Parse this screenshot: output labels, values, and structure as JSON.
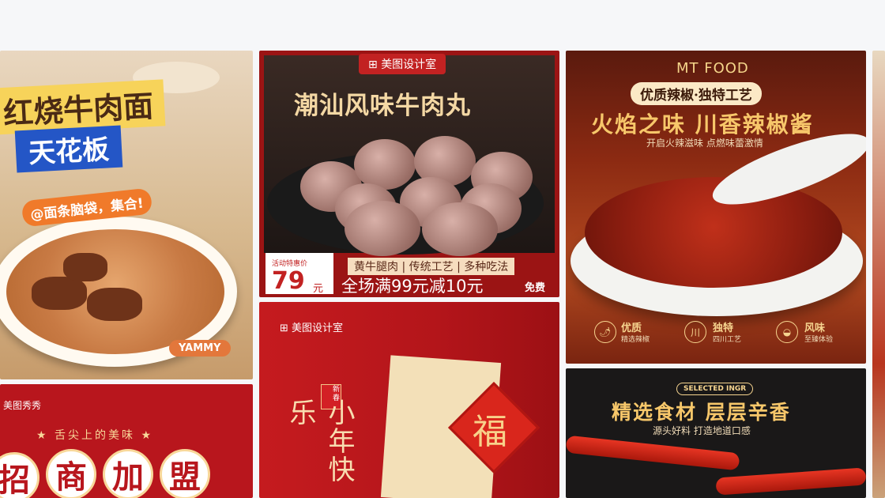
{
  "cards": {
    "noodle": {
      "title": "红烧牛肉面",
      "badge": "天花板",
      "pill": "@面条脑袋，集合!",
      "tag": "YAMMY",
      "colors": {
        "title_bg": "#f7d35a",
        "badge_bg": "#2456c6",
        "pill_bg": "#f07a2a"
      }
    },
    "beefball": {
      "logo": "美图设计室",
      "title": "潮汕风味牛肉丸",
      "price_label": "活动特惠价",
      "price": "79",
      "price_unit": "元",
      "tags": "黄牛腿肉 | 传统工艺 | 多种吃法",
      "promo": "全场满99元减10元",
      "free": "免费",
      "colors": {
        "frame": "#9b1414",
        "title": "#f4d8a4"
      }
    },
    "chili_sauce": {
      "brand": "MT FOOD",
      "sub": "优质辣椒·独特工艺",
      "title": "火焰之味 川香辣椒酱",
      "desc": "开启火辣滋味 点燃味蕾激情",
      "features": [
        {
          "icon": "chili-icon",
          "glyph": "🌶",
          "label": "优质",
          "sub": "精选辣椒"
        },
        {
          "icon": "sichuan-icon",
          "glyph": "川",
          "label": "独特",
          "sub": "四川工艺"
        },
        {
          "icon": "bowl-icon",
          "glyph": "◒",
          "label": "风味",
          "sub": "至臻体验"
        }
      ]
    },
    "franchise": {
      "logo": "美图秀秀",
      "sub": "★ 舌尖上的美味 ★",
      "chars": [
        "招",
        "商",
        "加",
        "盟"
      ]
    },
    "new_year": {
      "logo": "美图设计室",
      "seal": "新春",
      "vertical": "小年快乐",
      "fu": "福"
    },
    "chili": {
      "tag": "SELECTED INGR",
      "title": "精选食材 层层辛香",
      "desc": "源头好料 打造地道口感"
    }
  }
}
